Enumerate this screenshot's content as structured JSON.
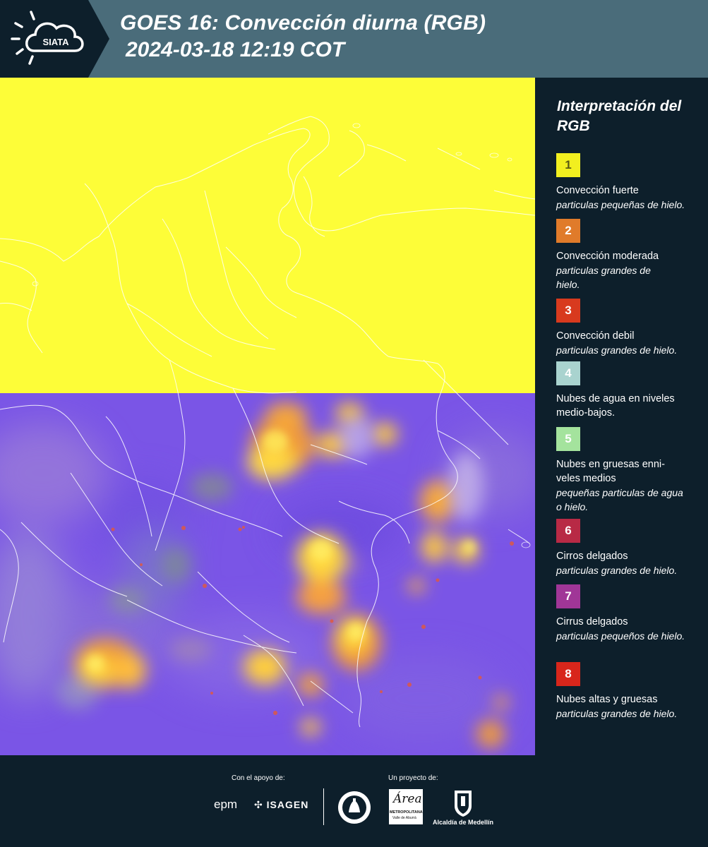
{
  "header": {
    "logo_text": "SIATA",
    "title_line1": "GOES 16: Convección diurna (RGB)",
    "title_line2": "2024-03-18 12:19 COT",
    "background": "#4a6c7a"
  },
  "legend": {
    "title": "Interpretación del RGB",
    "items": [
      {
        "number": "1",
        "color": "#f2ef1f",
        "number_color": "#5a5a12",
        "label": "Convección fuerte",
        "detail": "particulas pequeñas de hielo."
      },
      {
        "number": "2",
        "color": "#e07b2a",
        "number_color": "#ffffff",
        "label": "Convección moderada",
        "detail": "particulas grandes de hielo."
      },
      {
        "number": "3",
        "color": "#d83a1e",
        "number_color": "#ffffff",
        "label": "Convección debil",
        "detail": "particulas grandes de hielo."
      },
      {
        "number": "4",
        "color": "#a9d3cf",
        "number_color": "#ffffff",
        "label": "Nubes de agua en niveles medio-bajos.",
        "detail": ""
      },
      {
        "number": "5",
        "color": "#a4e39d",
        "number_color": "#ffffff",
        "label": "Nubes en gruesas enni-veles medios",
        "detail": "pequeñas particulas de agua o hielo."
      },
      {
        "number": "6",
        "color": "#b82a45",
        "number_color": "#ffffff",
        "label": "Cirros delgados",
        "detail": "particulas grandes de hielo."
      },
      {
        "number": "7",
        "color": "#a03697",
        "number_color": "#ffffff",
        "label": "Cirrus delgados",
        "detail": "particulas pequeños de hielo."
      },
      {
        "number": "8",
        "color": "#d8261b",
        "number_color": "#ffffff",
        "label": "Nubes altas y gruesas",
        "detail": "particulas grandes de hielo."
      }
    ]
  },
  "footer": {
    "support_label": "Con el apoyo de:",
    "project_label": "Un proyecto de:",
    "sponsor_epm": "epm",
    "sponsor_isagen": "ISAGEN",
    "sponsor_area_name": "Área",
    "sponsor_area_sub1": "METROPOLITANA",
    "sponsor_area_sub2": "Valle de Aburrá",
    "sponsor_alcaldia": "Alcaldía de Medellín"
  },
  "map": {
    "yellow_area_color": "#fdfd38",
    "imagery_base_color": "#7a55e6"
  }
}
